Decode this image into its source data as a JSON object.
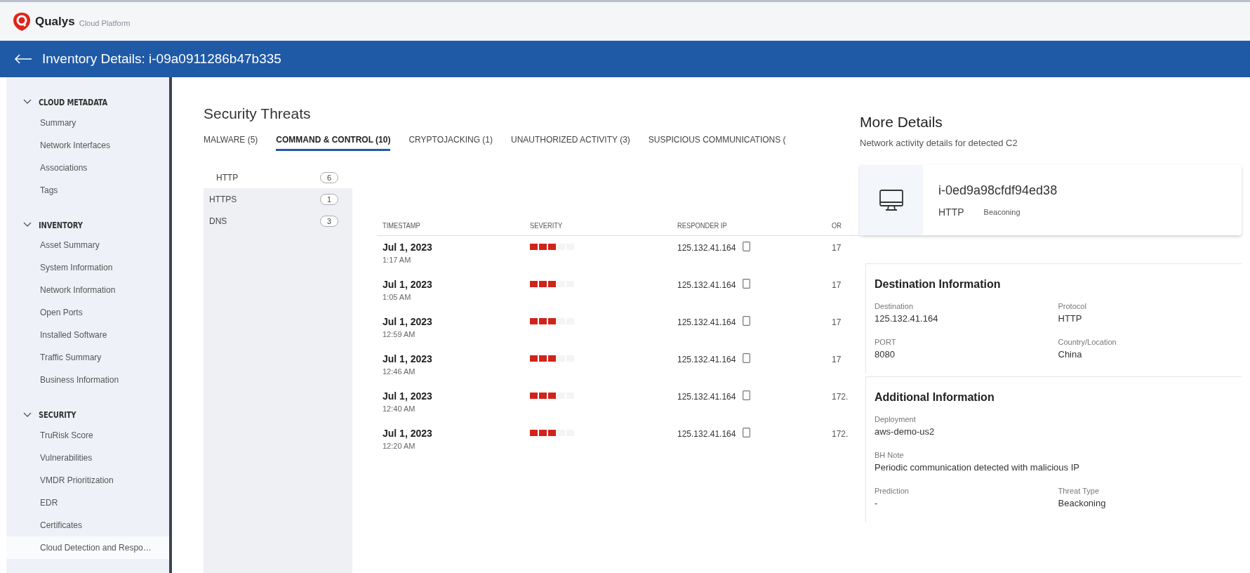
{
  "app": {
    "logo_text": "Qualys",
    "product": "Cloud Platform"
  },
  "header": {
    "title": "Inventory Details: i-09a0911286b47b335"
  },
  "sidebar": {
    "sections": [
      {
        "title": "CLOUD METADATA",
        "expanded": true,
        "items": [
          {
            "label": "Summary",
            "selected": false
          },
          {
            "label": "Network Interfaces",
            "selected": false
          },
          {
            "label": "Associations",
            "selected": false
          },
          {
            "label": "Tags",
            "selected": false
          }
        ]
      },
      {
        "title": "INVENTORY",
        "expanded": true,
        "items": [
          {
            "label": "Asset Summary",
            "selected": false
          },
          {
            "label": "System Information",
            "selected": false
          },
          {
            "label": "Network Information",
            "selected": false
          },
          {
            "label": "Open Ports",
            "selected": false
          },
          {
            "label": "Installed Software",
            "selected": false
          },
          {
            "label": "Traffic Summary",
            "selected": false
          },
          {
            "label": "Business Information",
            "selected": false
          }
        ]
      },
      {
        "title": "SECURITY",
        "expanded": true,
        "items": [
          {
            "label": "TruRisk Score",
            "selected": false
          },
          {
            "label": "Vulnerabilities",
            "selected": false
          },
          {
            "label": "VMDR Prioritization",
            "selected": false
          },
          {
            "label": "EDR",
            "selected": false
          },
          {
            "label": "Certificates",
            "selected": false
          },
          {
            "label": "Cloud Detection and Respo…",
            "selected": true
          }
        ]
      }
    ]
  },
  "main": {
    "title": "Security Threats",
    "tabs": [
      {
        "label": "MALWARE (5)",
        "selected": false
      },
      {
        "label": "COMMAND & CONTROL (10)",
        "selected": true
      },
      {
        "label": "CRYPTOJACKING (1)",
        "selected": false
      },
      {
        "label": "UNAUTHORIZED ACTIVITY (3)",
        "selected": false
      },
      {
        "label": "SUSPICIOUS COMMUNICATIONS (",
        "selected": false
      }
    ],
    "subtabs": [
      {
        "label": "HTTP",
        "count": "6",
        "selected": true
      },
      {
        "label": "HTTPS",
        "count": "1",
        "selected": false
      },
      {
        "label": "DNS",
        "count": "3",
        "selected": false
      }
    ],
    "table": {
      "columns": [
        "TIMESTAMP",
        "SEVERITY",
        "RESPONDER IP",
        "OR"
      ],
      "rows": [
        {
          "date": "Jul 1, 2023",
          "time": "1:17 AM",
          "stars": 3,
          "ip": "125.132.41.164",
          "column_4": "17"
        },
        {
          "date": "Jul 1, 2023",
          "time": "1:05  AM",
          "stars": 3,
          "ip": "125.132.41.164",
          "column_4": "17"
        },
        {
          "date": "Jul 1, 2023",
          "time": "12:59  AM",
          "stars": 3,
          "ip": "125.132.41.164",
          "column_4": "17"
        },
        {
          "date": "Jul 1, 2023",
          "time": "12:46  AM",
          "stars": 3,
          "ip": "125.132.41.164",
          "column_4": "17"
        },
        {
          "date": "Jul 1, 2023",
          "time": "12:40  AM",
          "stars": 3,
          "ip": "125.132.41.164",
          "column_4": "172."
        },
        {
          "date": "Jul 1, 2023",
          "time": "12:20  AM",
          "stars": 3,
          "ip": "125.132.41.164",
          "column_4": "172."
        }
      ]
    }
  },
  "details": {
    "title": "More Details",
    "subtitle": "Network activity details for detected C2",
    "card": {
      "id": "i-0ed9a98cfdf94ed38",
      "protocol": "HTTP",
      "tag": "Beaconing"
    },
    "sections": [
      {
        "title": "Destination Information",
        "fields": [
          {
            "label": "Destination",
            "value": "125.132.41.164",
            "wide": false
          },
          {
            "label": "Protocol",
            "value": "HTTP",
            "wide": false
          },
          {
            "label": "PORT",
            "value": "8080",
            "wide": false
          },
          {
            "label": "Country/Location",
            "value": "China",
            "wide": false
          }
        ]
      },
      {
        "title": "Additional Information",
        "fields": [
          {
            "label": "Deployment",
            "value": "aws-demo-us2",
            "wide": true
          },
          {
            "label": "BH Note",
            "value": "Periodic communication detected with malicious IP",
            "wide": true
          },
          {
            "label": "Prediction",
            "value": "-",
            "wide": false
          },
          {
            "label": "Threat Type",
            "value": "Beackoning",
            "wide": false
          }
        ]
      }
    ]
  }
}
